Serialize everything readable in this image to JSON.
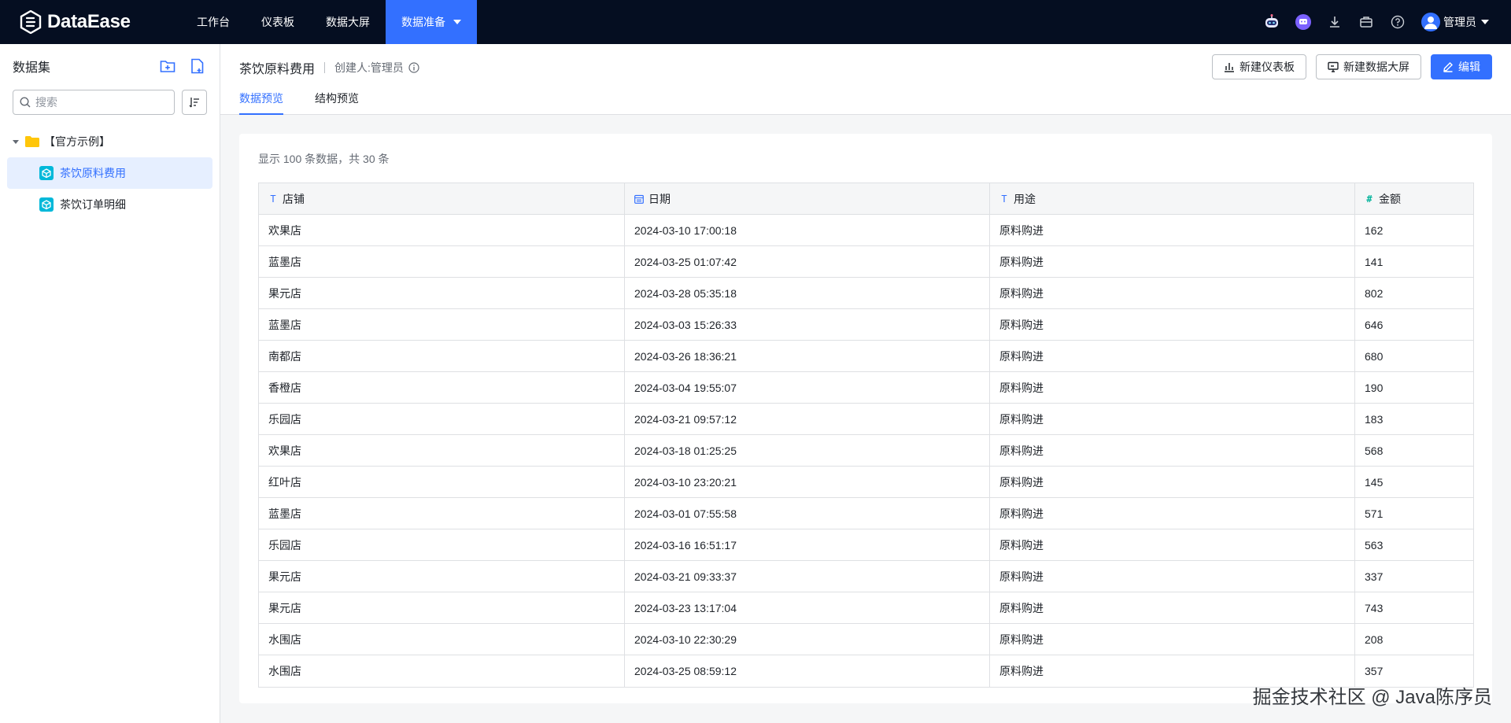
{
  "app": {
    "name": "DataEase"
  },
  "nav": {
    "items": [
      {
        "label": "工作台"
      },
      {
        "label": "仪表板"
      },
      {
        "label": "数据大屏"
      },
      {
        "label": "数据准备"
      }
    ],
    "active_index": 3,
    "user": "管理员"
  },
  "sidebar": {
    "title": "数据集",
    "search_placeholder": "搜索",
    "folder": "【官方示例】",
    "items": [
      {
        "label": "茶饮原料费用",
        "active": true
      },
      {
        "label": "茶饮订单明细",
        "active": false
      }
    ]
  },
  "header": {
    "title": "茶饮原料费用",
    "creator": "创建人:管理员",
    "buttons": {
      "new_dashboard": "新建仪表板",
      "new_screen": "新建数据大屏",
      "edit": "编辑"
    },
    "tabs": [
      {
        "label": "数据预览",
        "active": true
      },
      {
        "label": "结构预览",
        "active": false
      }
    ]
  },
  "preview": {
    "summary": "显示  100  条数据，共  30  条",
    "columns": [
      {
        "label": "店铺",
        "type": "text"
      },
      {
        "label": "日期",
        "type": "date"
      },
      {
        "label": "用途",
        "type": "text"
      },
      {
        "label": "金额",
        "type": "number"
      }
    ],
    "rows": [
      [
        "欢果店",
        "2024-03-10 17:00:18",
        "原料购进",
        "162"
      ],
      [
        "蓝墨店",
        "2024-03-25 01:07:42",
        "原料购进",
        "141"
      ],
      [
        "果元店",
        "2024-03-28 05:35:18",
        "原料购进",
        "802"
      ],
      [
        "蓝墨店",
        "2024-03-03 15:26:33",
        "原料购进",
        "646"
      ],
      [
        "南都店",
        "2024-03-26 18:36:21",
        "原料购进",
        "680"
      ],
      [
        "香橙店",
        "2024-03-04 19:55:07",
        "原料购进",
        "190"
      ],
      [
        "乐园店",
        "2024-03-21 09:57:12",
        "原料购进",
        "183"
      ],
      [
        "欢果店",
        "2024-03-18 01:25:25",
        "原料购进",
        "568"
      ],
      [
        "红叶店",
        "2024-03-10 23:20:21",
        "原料购进",
        "145"
      ],
      [
        "蓝墨店",
        "2024-03-01 07:55:58",
        "原料购进",
        "571"
      ],
      [
        "乐园店",
        "2024-03-16 16:51:17",
        "原料购进",
        "563"
      ],
      [
        "果元店",
        "2024-03-21 09:33:37",
        "原料购进",
        "337"
      ],
      [
        "果元店",
        "2024-03-23 13:17:04",
        "原料购进",
        "743"
      ],
      [
        "水围店",
        "2024-03-10 22:30:29",
        "原料购进",
        "208"
      ],
      [
        "水围店",
        "2024-03-25 08:59:12",
        "原料购进",
        "357"
      ]
    ]
  },
  "watermark": "掘金技术社区 @ Java陈序员",
  "colors": {
    "nav_bg": "#050e21",
    "accent": "#3370ff",
    "number_icon": "#04b49c"
  }
}
